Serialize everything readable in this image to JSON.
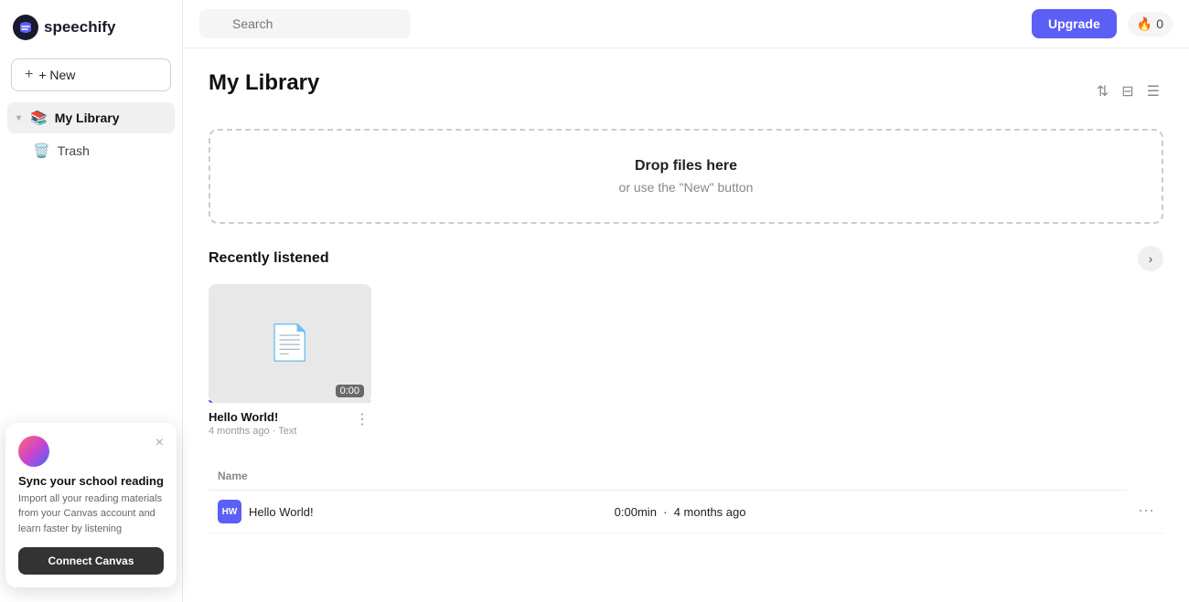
{
  "sidebar": {
    "logo": "speechify",
    "new_button_label": "+ New",
    "items": [
      {
        "id": "my-library",
        "label": "My Library",
        "icon": "📚",
        "active": true
      },
      {
        "id": "trash",
        "label": "Trash",
        "icon": "🗑️",
        "active": false
      }
    ]
  },
  "topbar": {
    "search_placeholder": "Search",
    "upgrade_label": "Upgrade",
    "fire_count": "0"
  },
  "main": {
    "page_title": "My Library",
    "drop_zone": {
      "title": "Drop files here",
      "subtitle": "or use the \"New\" button"
    },
    "recently_listened": {
      "section_title": "Recently listened",
      "items": [
        {
          "title": "Hello World!",
          "meta": "4 months ago · Text",
          "duration": "0:00",
          "progress": 2
        }
      ]
    },
    "list": {
      "column_name": "Name",
      "rows": [
        {
          "icon_text": "HW",
          "title": "Hello World!",
          "duration": "0:00min",
          "age": "4 months ago"
        }
      ]
    }
  },
  "canvas_popup": {
    "title": "Sync your school reading",
    "description": "Import all your reading materials from your Canvas account and learn faster by listening",
    "connect_label": "Connect Canvas",
    "close_label": "×"
  }
}
